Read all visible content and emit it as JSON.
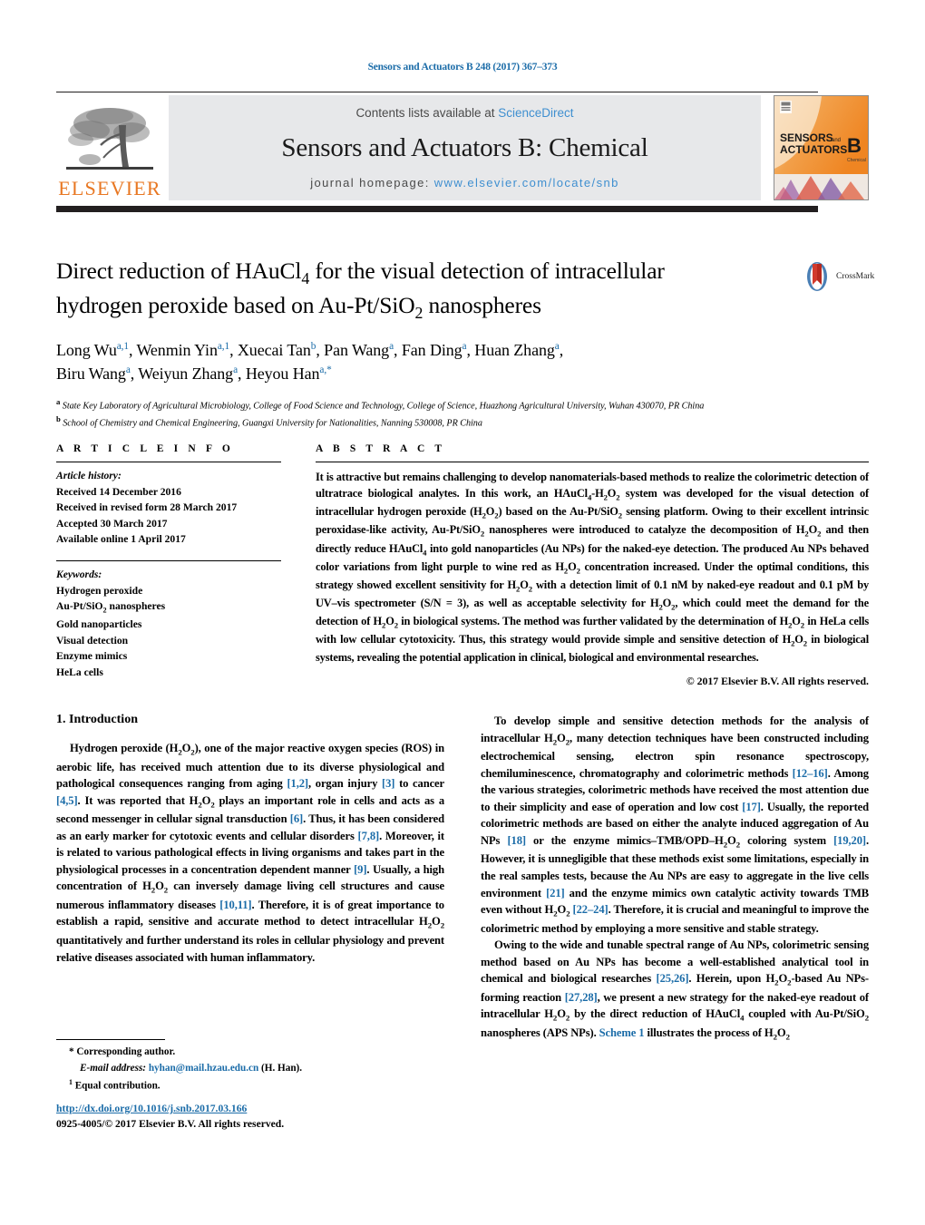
{
  "running_head": "Sensors and Actuators B 248 (2017) 367–373",
  "masthead": {
    "contents_prefix": "Contents lists available at ",
    "contents_link": "ScienceDirect",
    "journal_title": "Sensors and Actuators B: Chemical",
    "homepage_prefix": "journal homepage: ",
    "homepage_url": "www.elsevier.com/locate/snb",
    "publisher": "ELSEVIER",
    "cover_line1": "SENSORS",
    "cover_and": "and",
    "cover_line2": "ACTUATORS",
    "cover_letter": "B",
    "cover_sub": "Chemical"
  },
  "crossmark": {
    "label": "CrossMark"
  },
  "title": {
    "line1": "Direct reduction of HAuCl4 for the visual detection of intracellular",
    "line2": "hydrogen peroxide based on Au-Pt/SiO2 nanospheres"
  },
  "authors": [
    {
      "name": "Long Wu",
      "sup": "a,1",
      "sep": ", "
    },
    {
      "name": "Wenmin Yin",
      "sup": "a,1",
      "sep": ", "
    },
    {
      "name": "Xuecai Tan",
      "sup": "b",
      "sep": ", "
    },
    {
      "name": "Pan Wang",
      "sup": "a",
      "sep": ", "
    },
    {
      "name": "Fan Ding",
      "sup": "a",
      "sep": ", "
    },
    {
      "name": "Huan Zhang",
      "sup": "a",
      "sep": ", "
    },
    {
      "name": "Biru Wang",
      "sup": "a",
      "sep": ", "
    },
    {
      "name": "Weiyun Zhang",
      "sup": "a",
      "sep": ", "
    },
    {
      "name": "Heyou Han",
      "sup": "a,*",
      "sep": ""
    }
  ],
  "affiliations": [
    {
      "mark": "a",
      "text": "State Key Laboratory of Agricultural Microbiology, College of Food Science and Technology, College of Science, Huazhong Agricultural University, Wuhan 430070, PR China"
    },
    {
      "mark": "b",
      "text": "School of Chemistry and Chemical Engineering, Guangxi University for Nationalities, Nanning 530008, PR China"
    }
  ],
  "article_info": {
    "heading": "A R T I C L E   I N F O",
    "history_label": "Article history:",
    "history": [
      "Received 14 December 2016",
      "Received in revised form 28 March 2017",
      "Accepted 30 March 2017",
      "Available online 1 April 2017"
    ],
    "keywords_label": "Keywords:",
    "keywords": [
      "Hydrogen peroxide",
      "Au-Pt/SiO2 nanospheres",
      "Gold nanoparticles",
      "Visual detection",
      "Enzyme mimics",
      "HeLa cells"
    ]
  },
  "abstract": {
    "heading": "A B S T R A C T",
    "body": "It is attractive but remains challenging to develop nanomaterials-based methods to realize the colorimetric detection of ultratrace biological analytes. In this work, an HAuCl4-H2O2 system was developed for the visual detection of intracellular hydrogen peroxide (H2O2) based on the Au-Pt/SiO2 sensing platform. Owing to their excellent intrinsic peroxidase-like activity, Au-Pt/SiO2 nanospheres were introduced to catalyze the decomposition of H2O2 and then directly reduce HAuCl4 into gold nanoparticles (Au NPs) for the naked-eye detection. The produced Au NPs behaved color variations from light purple to wine red as H2O2 concentration increased. Under the optimal conditions, this strategy showed excellent sensitivity for H2O2 with a detection limit of 0.1 nM by naked-eye readout and 0.1 pM by UV–vis spectrometer (S/N = 3), as well as acceptable selectivity for H2O2, which could meet the demand for the detection of H2O2 in biological systems. The method was further validated by the determination of H2O2 in HeLa cells with low cellular cytotoxicity. Thus, this strategy would provide simple and sensitive detection of H2O2 in biological systems, revealing the potential application in clinical, biological and environmental researches.",
    "copyright": "© 2017 Elsevier B.V. All rights reserved."
  },
  "sections": {
    "intro_heading": "1.  Introduction",
    "left_p1": "Hydrogen peroxide (H2O2), one of the major reactive oxygen species (ROS) in aerobic life, has received much attention due to its diverse physiological and pathological consequences ranging from aging [1,2], organ injury [3] to cancer [4,5]. It was reported that H2O2 plays an important role in cells and acts as a second messenger in cellular signal transduction [6]. Thus, it has been considered as an early marker for cytotoxic events and cellular disorders [7,8]. Moreover, it is related to various pathological effects in living organisms and takes part in the physiological processes in a concentration dependent manner [9]. Usually, a high concentration of H2O2 can inversely damage living cell structures and cause numerous inflammatory diseases [10,11]. Therefore, it is of great importance to establish a rapid, sensitive and accurate method to detect intracellular H2O2 quantitatively and further understand its roles in cellular physiology and prevent relative diseases associated with human inflammatory.",
    "right_p1": "To develop simple and sensitive detection methods for the analysis of intracellular H2O2, many detection techniques have been constructed including electrochemical sensing, electron spin resonance spectroscopy, chemiluminescence, chromatography and colorimetric methods [12–16]. Among the various strategies, colorimetric methods have received the most attention due to their simplicity and ease of operation and low cost [17]. Usually, the reported colorimetric methods are based on either the analyte induced aggregation of Au NPs [18] or the enzyme mimics–TMB/OPD–H2O2 coloring system [19,20]. However, it is unnegligible that these methods exist some limitations, especially in the real samples tests, because the Au NPs are easy to aggregate in the live cells environment [21] and the enzyme mimics own catalytic activity towards TMB even without H2O2 [22–24]. Therefore, it is crucial and meaningful to improve the colorimetric method by employing a more sensitive and stable strategy.",
    "right_p2": "Owing to the wide and tunable spectral range of Au NPs, colorimetric sensing method based on Au NPs has become a well-established analytical tool in chemical and biological researches [25,26]. Herein, upon H2O2-based Au NPs-forming reaction [27,28], we present a new strategy for the naked-eye readout of intracellular H2O2 by the direct reduction of HAuCl4 coupled with Au-Pt/SiO2 nanospheres (APS NPs). Scheme 1 illustrates the process of H2O2"
  },
  "footnotes": {
    "corresponding": "* Corresponding author.",
    "email_label": "E-mail address:",
    "email": "hyhan@mail.hzau.edu.cn",
    "email_suffix": "(H. Han).",
    "equal": "1  Equal contribution."
  },
  "footer": {
    "doi": "http://dx.doi.org/10.1016/j.snb.2017.03.166",
    "issn_line": "0925-4005/© 2017 Elsevier B.V. All rights reserved."
  },
  "colors": {
    "link_blue": "#1b6ca8",
    "sd_blue": "#3f8fd0",
    "elsevier_orange": "#e87722",
    "band_gray": "#e7e8ea",
    "rule_black": "#231f20"
  }
}
